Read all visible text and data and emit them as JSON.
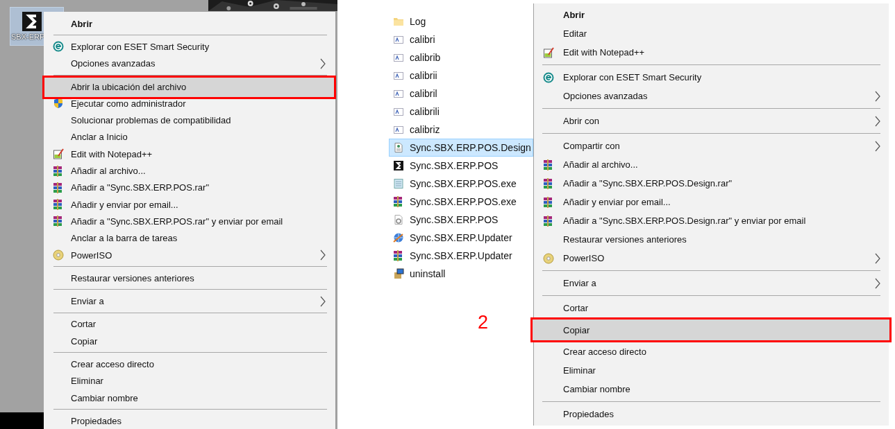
{
  "left": {
    "desktop": {
      "shortcut": {
        "label": "SBX-ERP",
        "selected": true
      }
    },
    "menu": [
      {
        "kind": "plain",
        "label": "Abrir",
        "default": true,
        "submenu": false,
        "highlighted": false
      },
      {
        "kind": "separator"
      },
      {
        "kind": "ring",
        "label": "Explorar con ESET Smart Security",
        "default": false,
        "submenu": false,
        "highlighted": false
      },
      {
        "kind": "plain",
        "label": "Opciones avanzadas",
        "default": false,
        "submenu": true,
        "highlighted": false
      },
      {
        "kind": "separator"
      },
      {
        "kind": "plain",
        "label": "Abrir la ubicación del archivo",
        "default": false,
        "submenu": false,
        "highlighted": true
      },
      {
        "kind": "shield",
        "label": "Ejecutar como administrador",
        "default": false,
        "submenu": false,
        "highlighted": false
      },
      {
        "kind": "plain",
        "label": "Solucionar problemas de compatibilidad",
        "default": false,
        "submenu": false,
        "highlighted": false
      },
      {
        "kind": "plain",
        "label": "Anclar a Inicio",
        "default": false,
        "submenu": false,
        "highlighted": false
      },
      {
        "kind": "notepad",
        "label": "Edit with Notepad++",
        "default": false,
        "submenu": false,
        "highlighted": false
      },
      {
        "kind": "books",
        "label": "Añadir al archivo...",
        "default": false,
        "submenu": false,
        "highlighted": false
      },
      {
        "kind": "books",
        "label": "Añadir a \"Sync.SBX.ERP.POS.rar\"",
        "default": false,
        "submenu": false,
        "highlighted": false
      },
      {
        "kind": "books",
        "label": "Añadir y enviar por email...",
        "default": false,
        "submenu": false,
        "highlighted": false
      },
      {
        "kind": "books",
        "label": "Añadir a \"Sync.SBX.ERP.POS.rar\" y enviar por email",
        "default": false,
        "submenu": false,
        "highlighted": false
      },
      {
        "kind": "plain",
        "label": "Anclar a la barra de tareas",
        "default": false,
        "submenu": false,
        "highlighted": false
      },
      {
        "kind": "disc",
        "label": "PowerISO",
        "default": false,
        "submenu": true,
        "highlighted": false
      },
      {
        "kind": "separator"
      },
      {
        "kind": "plain",
        "label": "Restaurar versiones anteriores",
        "default": false,
        "submenu": false,
        "highlighted": false
      },
      {
        "kind": "separator"
      },
      {
        "kind": "plain",
        "label": "Enviar a",
        "default": false,
        "submenu": true,
        "highlighted": false
      },
      {
        "kind": "separator"
      },
      {
        "kind": "plain",
        "label": "Cortar",
        "default": false,
        "submenu": false,
        "highlighted": false
      },
      {
        "kind": "plain",
        "label": "Copiar",
        "default": false,
        "submenu": false,
        "highlighted": false
      },
      {
        "kind": "separator"
      },
      {
        "kind": "plain",
        "label": "Crear acceso directo",
        "default": false,
        "submenu": false,
        "highlighted": false
      },
      {
        "kind": "plain",
        "label": "Eliminar",
        "default": false,
        "submenu": false,
        "highlighted": false
      },
      {
        "kind": "plain",
        "label": "Cambiar nombre",
        "default": false,
        "submenu": false,
        "highlighted": false
      },
      {
        "kind": "separator"
      },
      {
        "kind": "plain",
        "label": "Propiedades",
        "default": false,
        "submenu": false,
        "highlighted": false
      }
    ]
  },
  "right": {
    "files": [
      {
        "label": "Log",
        "kind": "folder",
        "selected": false
      },
      {
        "label": "calibri",
        "kind": "font",
        "selected": false
      },
      {
        "label": "calibrib",
        "kind": "font",
        "selected": false
      },
      {
        "label": "calibrii",
        "kind": "font",
        "selected": false
      },
      {
        "label": "calibril",
        "kind": "font",
        "selected": false
      },
      {
        "label": "calibrili",
        "kind": "font",
        "selected": false
      },
      {
        "label": "calibriz",
        "kind": "font",
        "selected": false
      },
      {
        "label": "Sync.SBX.ERP.POS.Design",
        "kind": "code",
        "selected": true
      },
      {
        "label": "Sync.SBX.ERP.POS",
        "kind": "app",
        "selected": false
      },
      {
        "label": "Sync.SBX.ERP.POS.exe",
        "kind": "notebook",
        "selected": false
      },
      {
        "label": "Sync.SBX.ERP.POS.exe",
        "kind": "books",
        "selected": false
      },
      {
        "label": "Sync.SBX.ERP.POS",
        "kind": "config",
        "selected": false
      },
      {
        "label": "Sync.SBX.ERP.Updater",
        "kind": "globe",
        "selected": false
      },
      {
        "label": "Sync.SBX.ERP.Updater",
        "kind": "books",
        "selected": false
      },
      {
        "label": "uninstall",
        "kind": "installer",
        "selected": false
      }
    ],
    "step_label": "2",
    "menu": [
      {
        "kind": "plain",
        "label": "Abrir",
        "default": true,
        "submenu": false,
        "highlighted": false
      },
      {
        "kind": "plain",
        "label": "Editar",
        "default": false,
        "submenu": false,
        "highlighted": false
      },
      {
        "kind": "notepad",
        "label": "Edit with Notepad++",
        "default": false,
        "submenu": false,
        "highlighted": false
      },
      {
        "kind": "separator"
      },
      {
        "kind": "ring",
        "label": "Explorar con ESET Smart Security",
        "default": false,
        "submenu": false,
        "highlighted": false
      },
      {
        "kind": "plain",
        "label": "Opciones avanzadas",
        "default": false,
        "submenu": true,
        "highlighted": false
      },
      {
        "kind": "separator"
      },
      {
        "kind": "plain",
        "label": "Abrir con",
        "default": false,
        "submenu": true,
        "highlighted": false
      },
      {
        "kind": "separator"
      },
      {
        "kind": "plain",
        "label": "Compartir con",
        "default": false,
        "submenu": true,
        "highlighted": false
      },
      {
        "kind": "books",
        "label": "Añadir al archivo...",
        "default": false,
        "submenu": false,
        "highlighted": false
      },
      {
        "kind": "books",
        "label": "Añadir a \"Sync.SBX.ERP.POS.Design.rar\"",
        "default": false,
        "submenu": false,
        "highlighted": false
      },
      {
        "kind": "books",
        "label": "Añadir y enviar por email...",
        "default": false,
        "submenu": false,
        "highlighted": false
      },
      {
        "kind": "books",
        "label": "Añadir a \"Sync.SBX.ERP.POS.Design.rar\" y enviar por email",
        "default": false,
        "submenu": false,
        "highlighted": false
      },
      {
        "kind": "plain",
        "label": "Restaurar versiones anteriores",
        "default": false,
        "submenu": false,
        "highlighted": false
      },
      {
        "kind": "disc",
        "label": "PowerISO",
        "default": false,
        "submenu": true,
        "highlighted": false
      },
      {
        "kind": "separator"
      },
      {
        "kind": "plain",
        "label": "Enviar a",
        "default": false,
        "submenu": true,
        "highlighted": false
      },
      {
        "kind": "separator"
      },
      {
        "kind": "plain",
        "label": "Cortar",
        "default": false,
        "submenu": false,
        "highlighted": false
      },
      {
        "kind": "plain",
        "label": "Copiar",
        "default": false,
        "submenu": false,
        "highlighted": true
      },
      {
        "kind": "separator"
      },
      {
        "kind": "plain",
        "label": "Crear acceso directo",
        "default": false,
        "submenu": false,
        "highlighted": false
      },
      {
        "kind": "plain",
        "label": "Eliminar",
        "default": false,
        "submenu": false,
        "highlighted": false
      },
      {
        "kind": "plain",
        "label": "Cambiar nombre",
        "default": false,
        "submenu": false,
        "highlighted": false
      },
      {
        "kind": "separator"
      },
      {
        "kind": "plain",
        "label": "Propiedades",
        "default": false,
        "submenu": false,
        "highlighted": false
      }
    ]
  }
}
